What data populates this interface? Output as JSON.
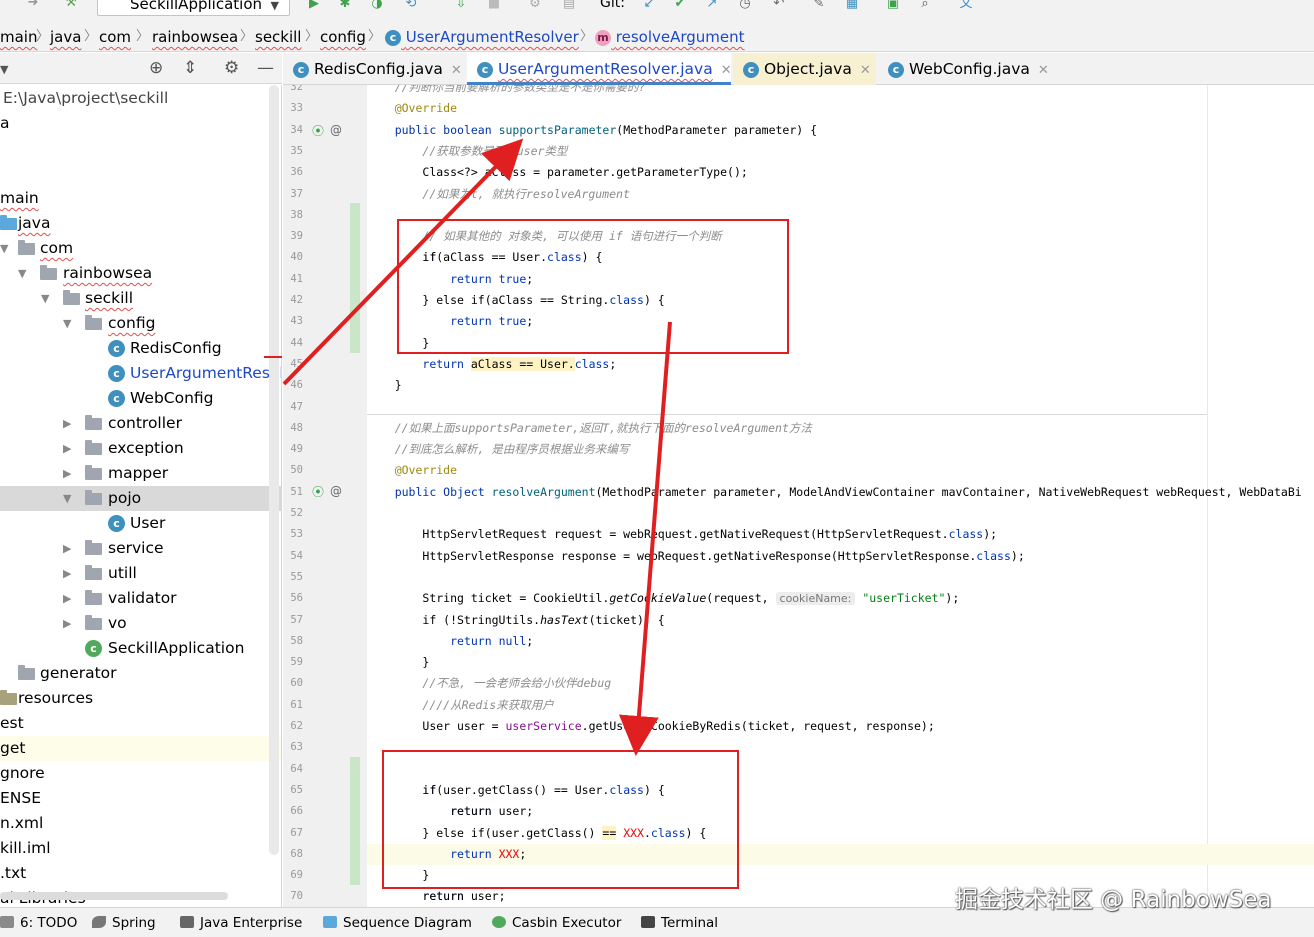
{
  "toolbar": {
    "run_config": "SeckillApplication",
    "git_label": "Git:"
  },
  "breadcrumb": [
    "main",
    "java",
    "com",
    "rainbowsea",
    "seckill",
    "config",
    "UserArgumentResolver",
    "resolveArgument"
  ],
  "project": {
    "root_path": "E:\\Java\\project\\seckill",
    "items": [
      "a",
      "main",
      "java",
      "com",
      "rainbowsea",
      "seckill",
      "config",
      "RedisConfig",
      "UserArgumentResolv",
      "WebConfig",
      "controller",
      "exception",
      "mapper",
      "pojo",
      "User",
      "service",
      "utill",
      "validator",
      "vo",
      "SeckillApplication",
      "generator",
      "resources",
      "est",
      "get",
      "gnore",
      "ENSE",
      "n.xml",
      "kill.iml",
      ".txt",
      "al Libraries"
    ]
  },
  "tabs": [
    "RedisConfig.java",
    "UserArgumentResolver.java",
    "Object.java",
    "WebConfig.java"
  ],
  "editor": {
    "line_numbers": [
      "32",
      "33",
      "34",
      "35",
      "36",
      "37",
      "38",
      "39",
      "40",
      "41",
      "42",
      "43",
      "44",
      "45",
      "46",
      "47",
      "48",
      "49",
      "50",
      "51",
      "52",
      "53",
      "54",
      "55",
      "56",
      "57",
      "58",
      "59",
      "60",
      "61",
      "62",
      "63",
      "64",
      "65",
      "66",
      "67",
      "68",
      "69",
      "70"
    ],
    "code": {
      "l32": "//判断你当前要解析的参数类型是不是你需要的?",
      "l33": "@Override",
      "l34a": "public boolean ",
      "l34b": "supportsParameter",
      "l34c": "(MethodParameter parameter) {",
      "l35": "//获取参数是不是user类型",
      "l36": "Class<?> aClass = parameter.getParameterType();",
      "l37": "//如果为t, 就执行resolveArgument",
      "l39": "// 如果其他的 对象类, 可以使用 if 语句进行一个判断",
      "l40a": "if(aClass == User.",
      "l40b": "class",
      "l40c": ") {",
      "l41a": "return ",
      "l41b": "true",
      "l41c": ";",
      "l42a": "} else if(aClass == String.",
      "l42b": "class",
      "l42c": ") {",
      "l43a": "return ",
      "l43b": "true",
      "l43c": ";",
      "l44": "}",
      "l45a": "return ",
      "l45b": "aClass == User.",
      "l45c": "class",
      "l45d": ";",
      "l46": "}",
      "l48": "//如果上面supportsParameter,返回T,就执行下面的resolveArgument方法",
      "l49": "//到底怎么解析, 是由程序员根据业务来编写",
      "l50": "@Override",
      "l51a": "public Object ",
      "l51b": "resolveArgument",
      "l51c": "(MethodParameter parameter, ModelAndViewContainer mavContainer, NativeWebRequest webRequest, WebDataBi",
      "l53a": "HttpServletRequest request = webRequest.getNativeRequest(HttpServletRequest.",
      "l53b": "class",
      "l53c": ");",
      "l54a": "HttpServletResponse response = webRequest.getNativeResponse(HttpServletResponse.",
      "l54b": "class",
      "l54c": ");",
      "l56a": "String ticket = CookieUtil.",
      "l56b": "getCookieValue",
      "l56c": "(request, ",
      "l56hint": "cookieName:",
      "l56d": "\"userTicket\"",
      "l56e": ");",
      "l57a": "if (!StringUtils.",
      "l57b": "hasText",
      "l57c": "(ticket)) {",
      "l58a": "return ",
      "l58b": "null",
      "l58c": ";",
      "l59": "}",
      "l60": "//不急, 一会老师会给小伙伴debug",
      "l61": "////从Redis来获取用户",
      "l62a": "User user = ",
      "l62b": "userService",
      "l62c": ".getUserByCookieByRedis(ticket, request, response);",
      "l65a": "if(user.getClass() == User.",
      "l65b": "class",
      "l65c": ") {",
      "l66": "return user;",
      "l67a": "} else if(user.getClass() ",
      "l67b": "==",
      "l67c": " ",
      "l67d": "XXX",
      "l67e": ".",
      "l67f": "class",
      "l67g": ") {",
      "l68a": "return ",
      "l68b": "XXX",
      "l68c": ";",
      "l69": "}",
      "l70": "return user;"
    }
  },
  "bottom_bar": [
    "6: TODO",
    "Spring",
    "Java Enterprise",
    "Sequence Diagram",
    "Casbin Executor",
    "Terminal"
  ],
  "watermark": "掘金技术社区 @ RainbowSea",
  "colors": {
    "annotation_red": "#e02020",
    "keyword": "#0033b3",
    "string": "#067d17",
    "comment": "#8c8c8c"
  }
}
